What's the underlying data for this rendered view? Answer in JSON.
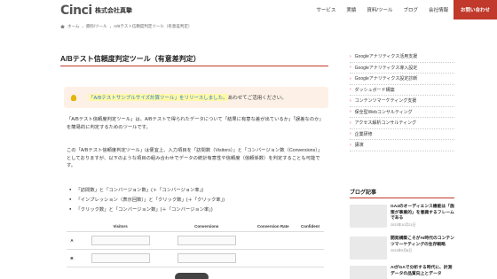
{
  "header": {
    "logo_text": "Cinci",
    "company": "株式会社真摯",
    "nav": [
      "サービス",
      "実績",
      "資料/ツール",
      "ブログ",
      "会社情報"
    ],
    "contact": "お問い合わせ"
  },
  "breadcrumb": [
    "ホーム",
    "資料/ツール",
    "A/Bテスト信頼度判定ツール（有意差判定）"
  ],
  "page_title": "A/Bテスト信頼度判定ツール（有意差判定）",
  "notice": {
    "link": "「A/Bテストサンプルサイズ計算ツール」をリリースしました。",
    "rest": "あわせてご活用ください。"
  },
  "intro": "「A/Bテスト信頼度判定ツール」は、A/Bテストで得られたデータについて「結果に有意な差が出ているか」「誤差なのか」を簡易的に判定するためのツールです。",
  "intro2": "この「A/Bテスト信頼度判定ツール」は便宜上、入力項目を「訪問数（Visitors）」と「コンバージョン数（Conversions）」としておりますが、以下のような項目の組み合わせでデータの統計有意性や信頼度（信頼係数）を判定することも可能です。",
  "list": [
    "「訪問数」と「コンバージョン数」(＋「コンバージョン率」)",
    "「インプレッション（表示回数）」と「クリック数」(＋「クリック率」)",
    "「クリック数」と「コンバージョン数」(＋「コンバージョン率」)"
  ],
  "table": {
    "headers": [
      "",
      "Visitors",
      "Conversions",
      "Conversion Rate",
      "Confident"
    ],
    "rows": [
      "A",
      "B"
    ]
  },
  "sidebar": {
    "items": [
      "Googleアナリティクス活用支援",
      "Googleアナリティクス導入設定",
      "Googleアナリティクス設定診断",
      "ダッシュボード構築",
      "コンテンツマーケティング支援",
      "保全型Webコンサルティング",
      "アクセス解析コンサルティング",
      "企業研修",
      "講演"
    ],
    "blog_heading": "ブログ記事",
    "posts": [
      {
        "title": "GA4のオーディエンス機能は「施策が事業的」を意識するフレームである",
        "date": "2023年10月21日"
      },
      {
        "title": "開発構築こそがAI時代のコンテンツマーケティングの生存戦略",
        "date": "2023年9月8日"
      },
      {
        "title": "AIがGAで分析する時代に、計測データの品質向上とデータ"
      }
    ]
  }
}
